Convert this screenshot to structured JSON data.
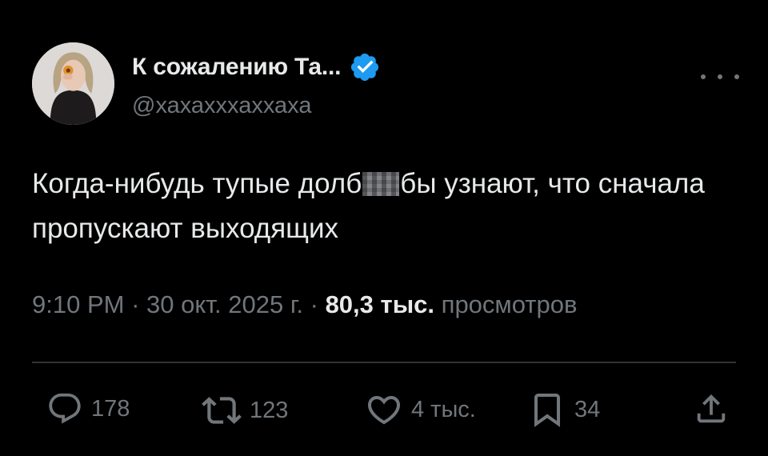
{
  "author": {
    "name": "К сожалению Та...",
    "handle": "@хахахххаххаха",
    "verified": true,
    "verified_color": "#1d9bf0"
  },
  "tweet": {
    "text_part1": "Когда-нибудь тупые долб",
    "text_part2": "бы узнают, что сначала пропускают выходящих"
  },
  "meta": {
    "time": "9:10 PM",
    "separator": "·",
    "date": "30 окт. 2025 г.",
    "views_count": "80,3 тыс.",
    "views_label": "просмотров"
  },
  "actions": {
    "replies": "178",
    "reposts": "123",
    "likes": "4 тыс.",
    "bookmarks": "34"
  },
  "icons": [
    "more-icon",
    "verified-badge-icon",
    "reply-icon",
    "repost-icon",
    "like-icon",
    "bookmark-icon",
    "share-icon"
  ],
  "colors": {
    "background": "#000000",
    "text": "#e7e9ea",
    "secondary": "#71767b",
    "divider": "#2f3336"
  }
}
